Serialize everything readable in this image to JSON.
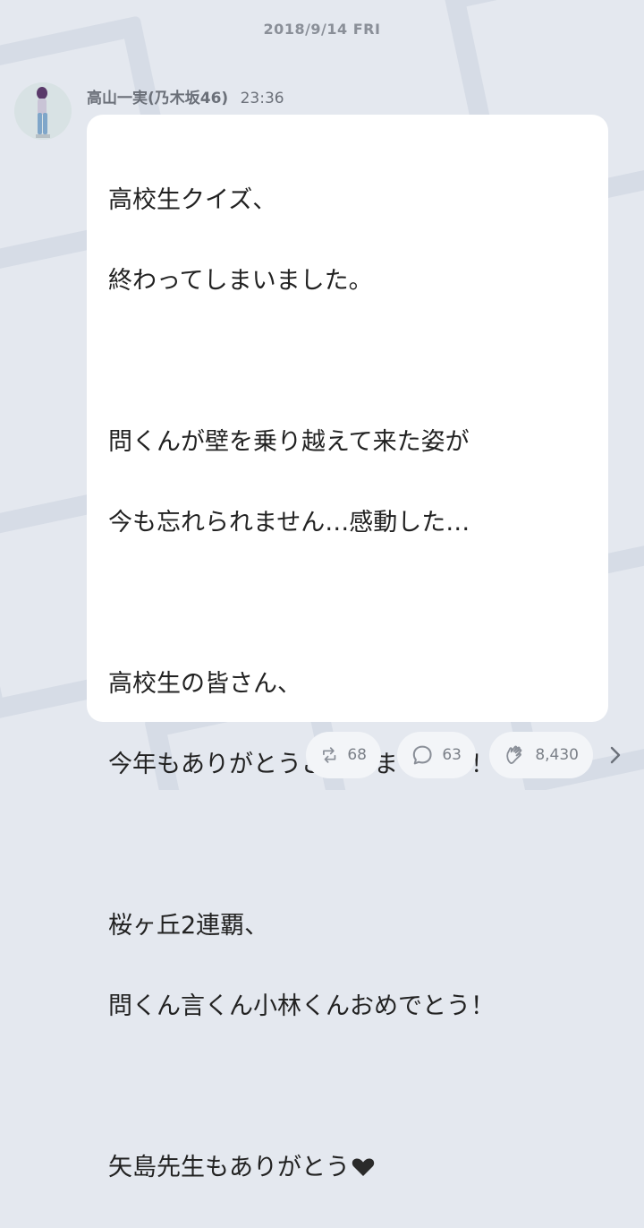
{
  "date": "2018/9/14 FRI",
  "post": {
    "author": "高山一実(乃木坂46)",
    "time": "23:36",
    "lines": [
      "高校生クイズ、",
      "終わってしまいました。",
      "",
      "問くんが壁を乗り越えて来た姿が",
      "今も忘れられません…感動した…",
      "",
      "高校生の皆さん、",
      "今年もありがとうございました！！",
      "",
      "桜ヶ丘2連覇、",
      "問くん言くん小林くんおめでとう！",
      "",
      "矢島先生もありがとう"
    ],
    "last_line_icon": "heart-icon"
  },
  "reactions": {
    "repost_count": "68",
    "comment_count": "63",
    "clap_count": "8,430"
  },
  "colors": {
    "background": "#e4e8ef",
    "bubble": "#ffffff",
    "meta_text": "#8a8f98"
  }
}
